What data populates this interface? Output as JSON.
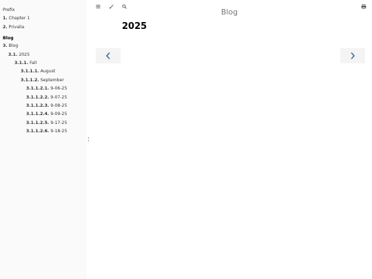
{
  "sidebar": {
    "prefix": "Prefix",
    "chapter1": {
      "num": "1.",
      "label": "Chapter 1"
    },
    "privalia": {
      "num": "2.",
      "label": "Privalia"
    },
    "part_title": "Blog",
    "blog": {
      "num": "3.",
      "label": "Blog"
    },
    "y2025": {
      "num": "3.1.",
      "label": "2025"
    },
    "fall": {
      "num": "3.1.1.",
      "label": "Fall"
    },
    "august": {
      "num": "3.1.1.1.",
      "label": "August"
    },
    "september": {
      "num": "3.1.1.2.",
      "label": "September"
    },
    "posts": [
      {
        "num": "3.1.1.2.1.",
        "label": "9-06-25"
      },
      {
        "num": "3.1.1.2.2.",
        "label": "9-07-25"
      },
      {
        "num": "3.1.1.2.3.",
        "label": "9-08-25"
      },
      {
        "num": "3.1.1.2.4.",
        "label": "9-09-25"
      },
      {
        "num": "3.1.1.2.5.",
        "label": "9-17-25"
      },
      {
        "num": "3.1.1.2.6.",
        "label": "9-18-25"
      }
    ]
  },
  "menubar": {
    "title": "Blog",
    "icons": [
      "menu-icon",
      "paintbrush-icon",
      "search-icon",
      "print-icon"
    ]
  },
  "content": {
    "heading": "2025"
  },
  "colors": {
    "sidebar_bg": "#fafafa",
    "nav_arrow": "#3a6b9a",
    "title": "#777777"
  }
}
